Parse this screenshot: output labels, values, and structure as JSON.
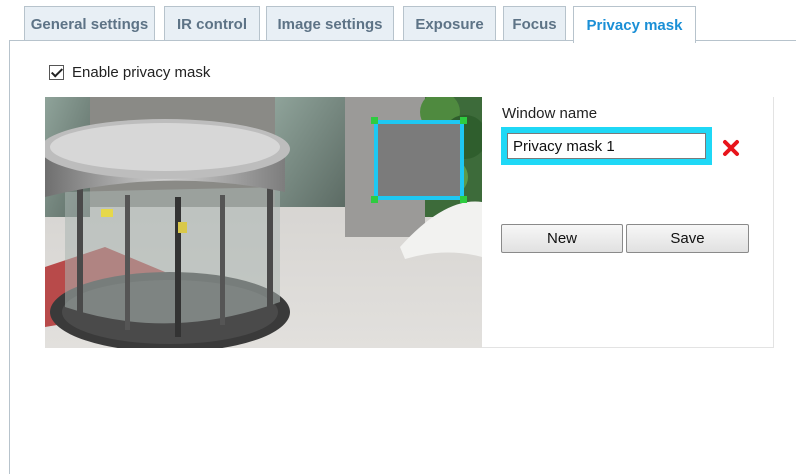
{
  "tabs": [
    {
      "label": "General settings"
    },
    {
      "label": "IR control"
    },
    {
      "label": "Image settings"
    },
    {
      "label": "Exposure"
    },
    {
      "label": "Focus"
    },
    {
      "label": "Privacy mask"
    }
  ],
  "active_tab": "Privacy mask",
  "enable_privacy_mask": {
    "label": "Enable privacy mask",
    "checked": true
  },
  "mask_editor": {
    "window_name_label": "Window name",
    "window_name_value": "Privacy mask 1",
    "new_button": "New",
    "save_button": "Save"
  },
  "colors": {
    "accent": "#1a8fd6",
    "mask_border": "#1fc8f2",
    "mask_fill": "#7b7b7b",
    "handle": "#2ecc40",
    "delete": "#e8141b"
  }
}
